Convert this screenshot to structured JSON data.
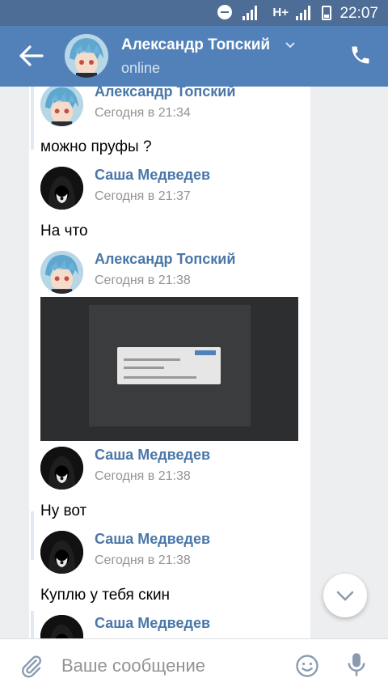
{
  "status_bar": {
    "time": "22:07",
    "network": "H+"
  },
  "header": {
    "name": "Александр Топский",
    "status": "online"
  },
  "messages": [
    {
      "author": "Александр Топский",
      "time": "Сегодня в 21:34",
      "text": "можно пруфы ?",
      "avatar": "anime-avatar"
    },
    {
      "author": "Саша Медведев",
      "time": "Сегодня в 21:37",
      "text": "На что",
      "avatar": "hooded-avatar"
    },
    {
      "author": "Александр Топский",
      "time": "Сегодня в 21:38",
      "attachment": "screenshot-photo",
      "avatar": "anime-avatar"
    },
    {
      "author": "Саша Медведев",
      "time": "Сегодня в 21:38",
      "text": "Ну вот",
      "avatar": "hooded-avatar"
    },
    {
      "author": "Саша Медведев",
      "time": "Сегодня в 21:38",
      "text": "Куплю у тебя скин",
      "avatar": "hooded-avatar"
    },
    {
      "author": "Саша Медведев",
      "avatar": "hooded-avatar"
    }
  ],
  "input": {
    "placeholder": "Ваше сообщение"
  },
  "colors": {
    "status_bar": "#4d6d97",
    "header": "#5181b8",
    "author": "#4a76a8",
    "timestamp": "#939393",
    "background": "#edeef0"
  },
  "icons": [
    "back-arrow-icon",
    "chevron-down-icon",
    "phone-icon",
    "scroll-down-icon",
    "paperclip-icon",
    "emoji-icon",
    "microphone-icon"
  ]
}
